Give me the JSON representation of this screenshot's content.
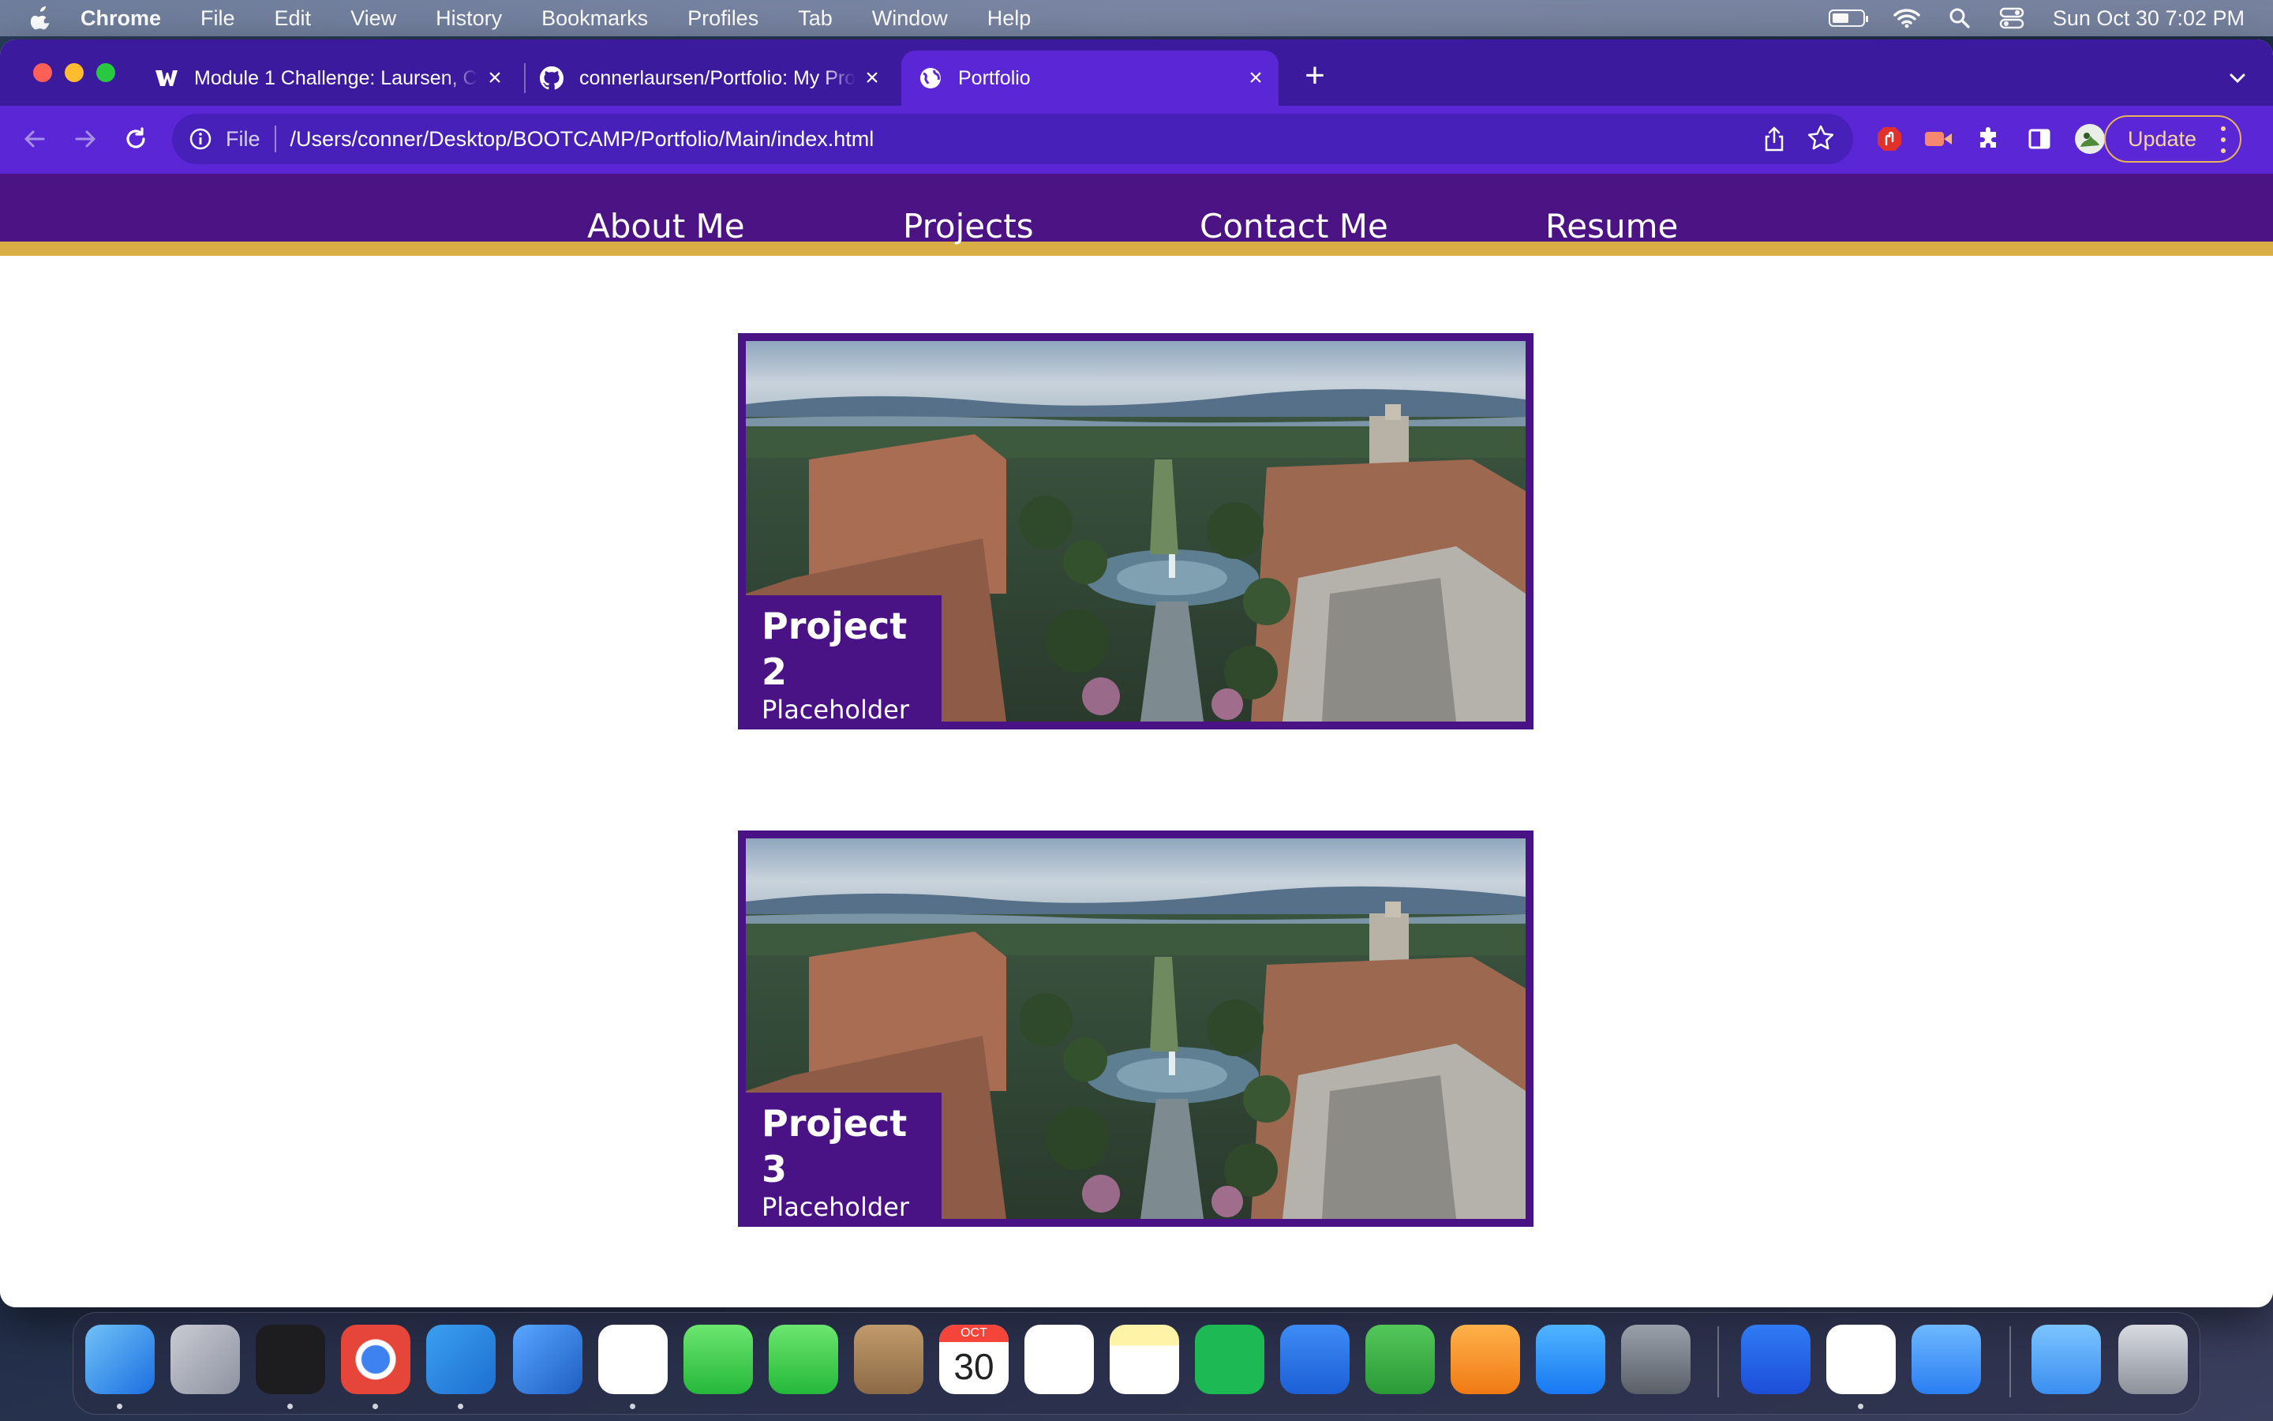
{
  "menubar": {
    "app_name": "Chrome",
    "items": [
      "File",
      "Edit",
      "View",
      "History",
      "Bookmarks",
      "Profiles",
      "Tab",
      "Window",
      "Help"
    ],
    "clock": "Sun Oct 30  7:02 PM",
    "battery_level": 0.55
  },
  "browser": {
    "tabs": [
      {
        "title": "Module 1 Challenge: Laursen, C",
        "icon": "w-logo-icon",
        "active": false
      },
      {
        "title": "connerlaursen/Portfolio: My Pro",
        "icon": "github-icon",
        "active": false
      },
      {
        "title": "Portfolio",
        "icon": "globe-icon",
        "active": true
      }
    ],
    "address": {
      "scheme": "File",
      "url": "/Users/conner/Desktop/BOOTCAMP/Portfolio/Main/index.html"
    },
    "update_label": "Update"
  },
  "site": {
    "nav": [
      "About Me",
      "Projects",
      "Contact Me",
      "Resume"
    ],
    "projects": [
      {
        "title": "Project 2",
        "subtitle": "Placeholder"
      },
      {
        "title": "Project 3",
        "subtitle": "Placeholder"
      }
    ]
  },
  "dock": {
    "apps": [
      "Finder",
      "Launchpad",
      "Terminal",
      "Chrome",
      "VS Code",
      "Xcode",
      "Slack",
      "Messages",
      "FaceTime",
      "Contacts",
      "Calendar",
      "Reminders",
      "Notes",
      "Spotify",
      "Keynote",
      "Numbers",
      "Pages",
      "App Store",
      "System Preferences",
      "Sourcetree",
      "VS Code Insiders",
      "Mail",
      "Downloads",
      "Trash"
    ],
    "calendar_month": "OCT",
    "calendar_day": "30"
  },
  "colors": {
    "site_purple": "#4b1383",
    "site_gold": "#d9ad45",
    "chrome_tabstrip": "#3c1a9e",
    "chrome_toolbar": "#5a26d6"
  }
}
